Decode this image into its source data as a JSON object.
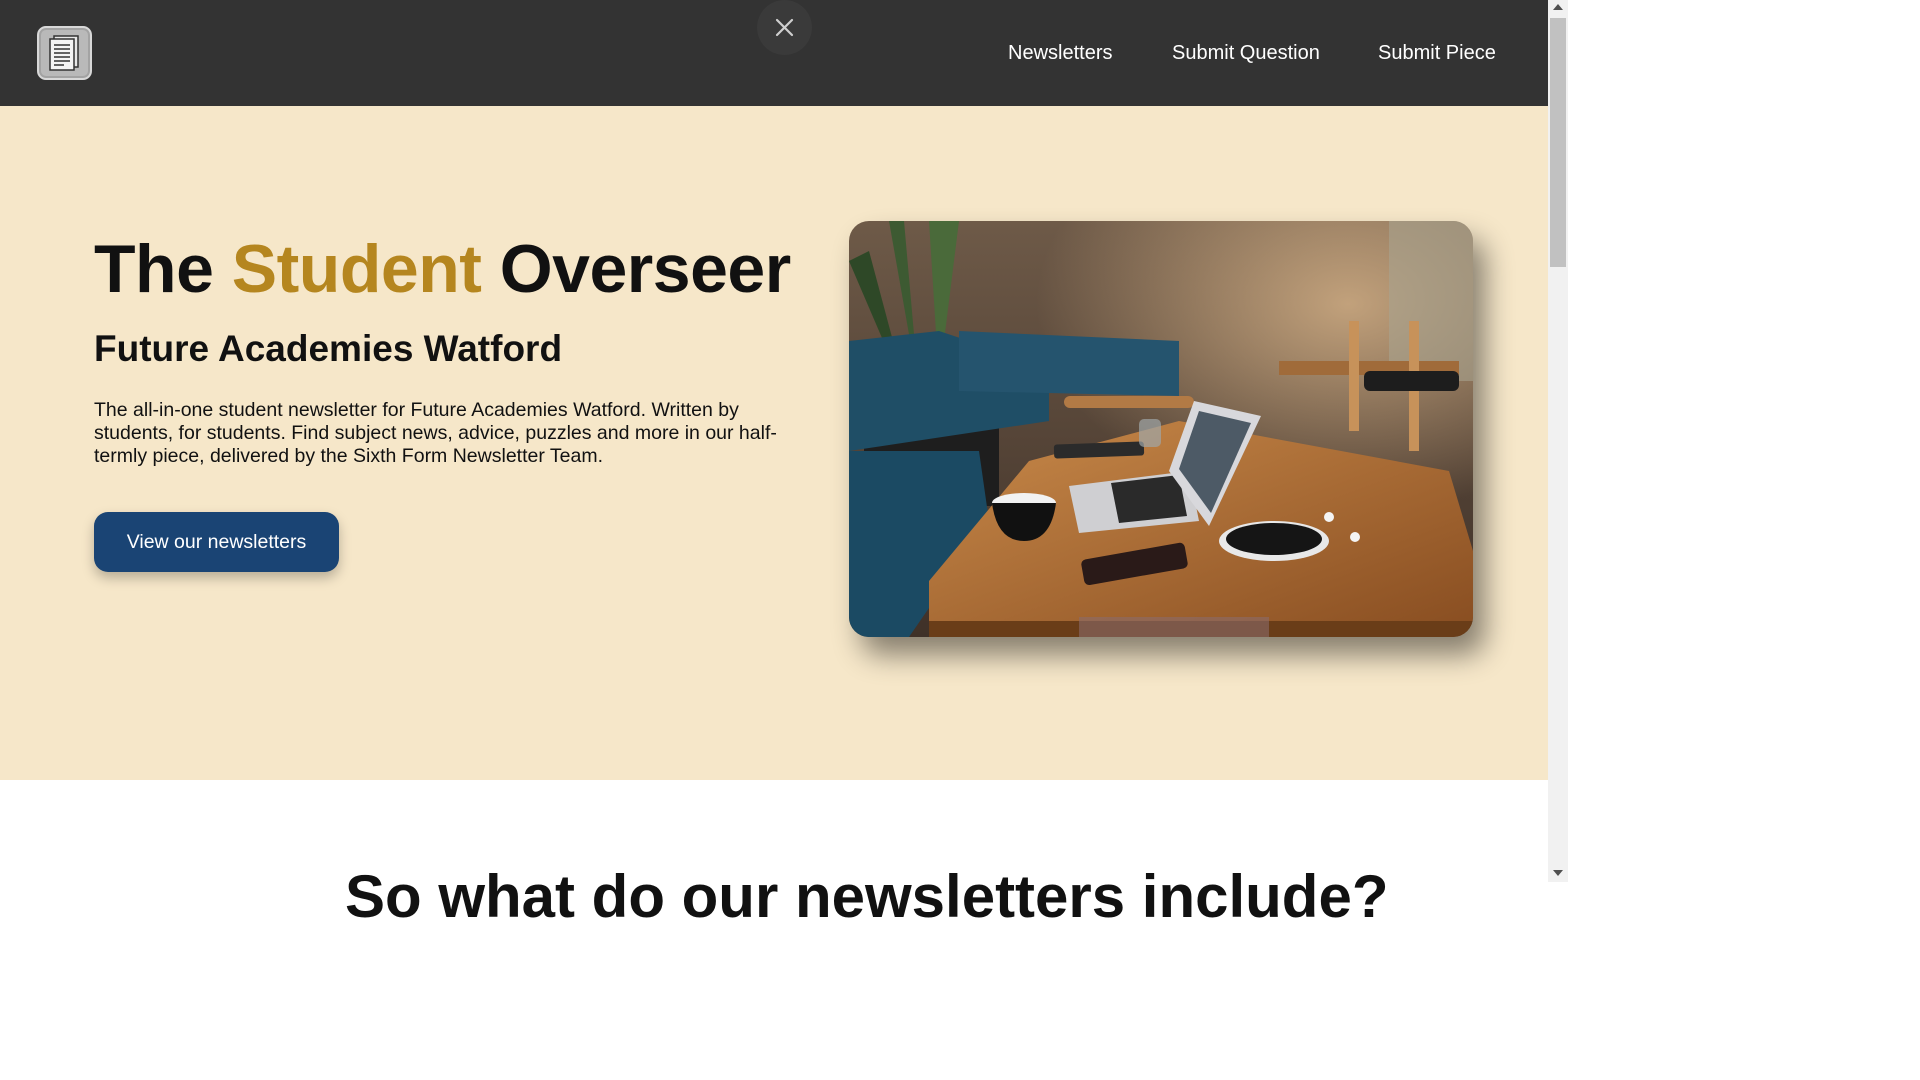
{
  "header": {
    "logo_icon": "newsletter-document-icon",
    "close_icon": "close-icon",
    "nav": [
      {
        "label": "Newsletters"
      },
      {
        "label": "Submit Question"
      },
      {
        "label": "Submit Piece"
      }
    ]
  },
  "hero": {
    "title_part1": "The ",
    "title_accent": "Student",
    "title_part2": " Overseer",
    "subtitle": "Future Academies Watford",
    "description": "The all-in-one student newsletter for Future Academies Watford. Written by students, for students. Find subject news, advice, puzzles and more in our half-termly piece, delivered by the Sixth Form Newsletter Team.",
    "cta_label": "View our newsletters",
    "image_subject": "cafe-table-laptop-photo"
  },
  "next_section": {
    "heading": "So what do our newsletters include?"
  },
  "colors": {
    "header_bg": "#333333",
    "hero_bg": "#f6e7c9",
    "accent": "#b5861f",
    "cta_bg": "#1a4474"
  }
}
